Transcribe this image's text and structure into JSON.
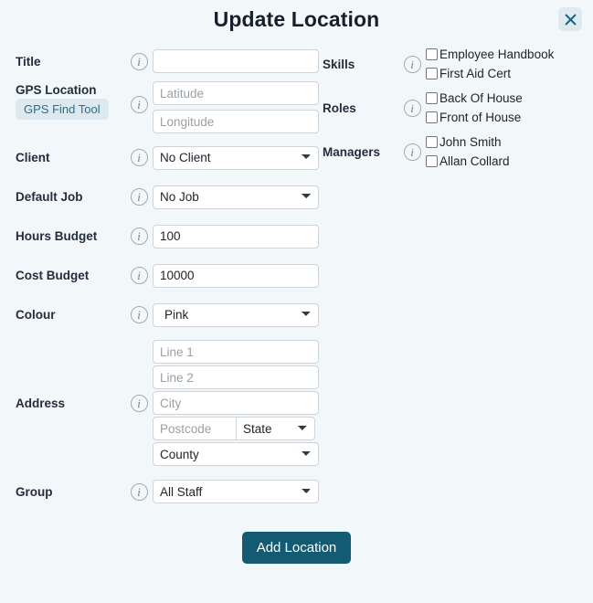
{
  "modal": {
    "title": "Update Location",
    "close_icon": "close-icon",
    "accent_color": "#135b73",
    "background_color": "#f2f7fa",
    "close_button_bg": "#dfe9f0"
  },
  "info_icon_glyph": "i",
  "left_column": {
    "title": {
      "label": "Title",
      "value": "",
      "placeholder": ""
    },
    "gps_location": {
      "label": "GPS Location",
      "tool_button": "GPS Find Tool",
      "latitude_placeholder": "Latitude",
      "latitude_value": "",
      "longitude_placeholder": "Longitude",
      "longitude_value": ""
    },
    "client": {
      "label": "Client",
      "value": "No Client",
      "options": [
        "No Client"
      ]
    },
    "default_job": {
      "label": "Default Job",
      "value": "No Job",
      "options": [
        "No Job"
      ]
    },
    "hours_budget": {
      "label": "Hours Budget",
      "value": "100"
    },
    "cost_budget": {
      "label": "Cost Budget",
      "value": "10000"
    },
    "colour": {
      "label": "Colour",
      "value": "Pink",
      "options": [
        "Pink"
      ]
    },
    "address": {
      "label": "Address",
      "line1_placeholder": "Line 1",
      "line1_value": "",
      "line2_placeholder": "Line 2",
      "line2_value": "",
      "city_placeholder": "City",
      "city_value": "",
      "postcode_placeholder": "Postcode",
      "postcode_value": "",
      "state_value": "State",
      "state_options": [
        "State"
      ],
      "county_value": "County",
      "county_options": [
        "County"
      ]
    },
    "group": {
      "label": "Group",
      "value": "All Staff",
      "options": [
        "All Staff"
      ]
    }
  },
  "right_column": {
    "skills": {
      "label": "Skills",
      "items": [
        {
          "label": "Employee Handbook",
          "checked": false
        },
        {
          "label": "First Aid Cert",
          "checked": false
        }
      ]
    },
    "roles": {
      "label": "Roles",
      "items": [
        {
          "label": "Back Of House",
          "checked": false
        },
        {
          "label": "Front of House",
          "checked": false
        }
      ]
    },
    "managers": {
      "label": "Managers",
      "items": [
        {
          "label": "John Smith",
          "checked": false
        },
        {
          "label": "Allan Collard",
          "checked": false
        }
      ]
    }
  },
  "footer": {
    "submit_label": "Add Location"
  }
}
